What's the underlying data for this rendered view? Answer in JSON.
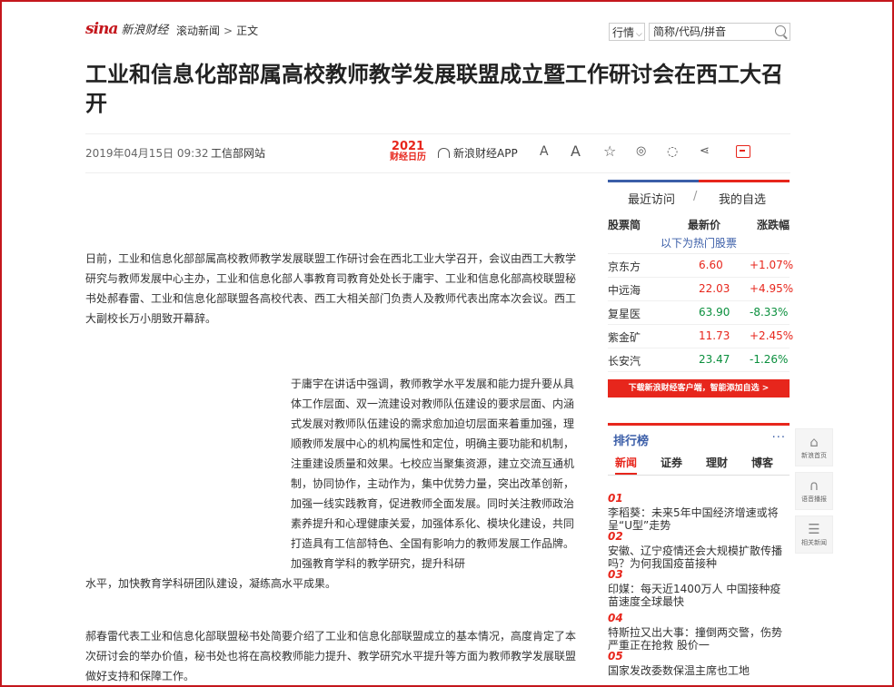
{
  "header": {
    "logo": "sina",
    "logo_sub": "新浪财经",
    "breadcrumb": [
      "滚动新闻",
      "正文"
    ],
    "breadcrumb_sep": ">",
    "quote_select": "行情",
    "search_placeholder": "简称/代码/拼音"
  },
  "article": {
    "title": "工业和信息化部部属高校教师教学发展联盟成立暨工作研讨会在西工大召开",
    "date": "2019年04月15日 09:32",
    "source": "工信部网站",
    "badge_year": "2021",
    "badge_text": "财经日历",
    "app_label": "新浪财经APP",
    "paragraphs": [
      "日前，工业和信息化部部属高校教师教学发展联盟工作研讨会在西北工业大学召开，会议由西工大教学研究与教师发展中心主办，工业和信息化部人事教育司教育处处长于庸宇、工业和信息化部高校联盟秘书处郝春雷、工业和信息化部联盟各高校代表、西工大相关部门负责人及教师代表出席本次会议。西工大副校长万小朋致开幕辞。",
      "于庸宇在讲话中强调，教师教学水平发展和能力提升要从具体工作层面、双一流建设对教师队伍建设的要求层面、内涵式发展对教师队伍建设的需求愈加迫切层面来着重加强，理顺教师发展中心的机构属性和定位，明确主要功能和机制，注重建设质量和效果。七校应当聚集资源，建立交流互通机制，协同协作，主动作为，集中优势力量，突出改革创新，加强一线实践教育，促进教师全面发展。同时关注教师政治素养提升和心理健康关爱，加强体系化、模块化建设，共同打造具有工信部特色、全国有影响力的教师发展工作品牌。加强教育学科的教学研究，提升科研",
      "水平，加快教育学科研团队建设，凝练高水平成果。",
      "郝春雷代表工业和信息化部联盟秘书处简要介绍了工业和信息化部联盟成立的基本情况，高度肯定了本次研讨会的举办价值，秘书处也将在高校教师能力提升、教学研究水平提升等方面为教师教学发展联盟做好支持和保障工作。"
    ]
  },
  "toolbar": {
    "font_small": "A",
    "font_large": "A",
    "comment_icon": "comment-icon"
  },
  "stocks": {
    "tab_recent": "最近访问",
    "tab_sep": "/",
    "tab_mine": "我的自选",
    "col_name": "股票简",
    "col_price": "最新价",
    "col_change": "涨跌幅",
    "hot_label": "以下为热门股票",
    "rows": [
      {
        "name": "京东方",
        "price": "6.60",
        "change": "+1.07%",
        "color": "#e7261c"
      },
      {
        "name": "中远海",
        "price": "22.03",
        "change": "+4.95%",
        "color": "#e7261c"
      },
      {
        "name": "复星医",
        "price": "63.90",
        "change": "-8.33%",
        "color": "#0a8f3d"
      },
      {
        "name": "紫金矿",
        "price": "11.73",
        "change": "+2.45%",
        "color": "#e7261c"
      },
      {
        "name": "长安汽",
        "price": "23.47",
        "change": "-1.26%",
        "color": "#0a8f3d"
      }
    ],
    "download_button": "下载新浪财经客户端，智能添加自选 >"
  },
  "ranking": {
    "title": "排行榜",
    "more": "···",
    "tabs": [
      "新闻",
      "证券",
      "理财",
      "博客"
    ],
    "items": [
      {
        "num": "01",
        "text": "李稻葵：未来5年中国经济增速或将呈“U型”走势"
      },
      {
        "num": "02",
        "text": "安徽、辽宁疫情还会大规模扩散传播吗？为何我国疫苗接种"
      },
      {
        "num": "03",
        "text": "印媒：每天近1400万人 中国接种疫苗速度全球最快"
      },
      {
        "num": "04",
        "text": "特斯拉又出大事：撞倒两交警，伤势严重正在抢救 股价一"
      },
      {
        "num": "05",
        "text": "国家发改委数保温主席也工地"
      }
    ]
  },
  "float_buttons": [
    {
      "icon": "home-icon",
      "label": "新浪首页"
    },
    {
      "icon": "headphone-icon",
      "label": "语音播报"
    },
    {
      "icon": "news-list-icon",
      "label": "相关新闻"
    }
  ]
}
